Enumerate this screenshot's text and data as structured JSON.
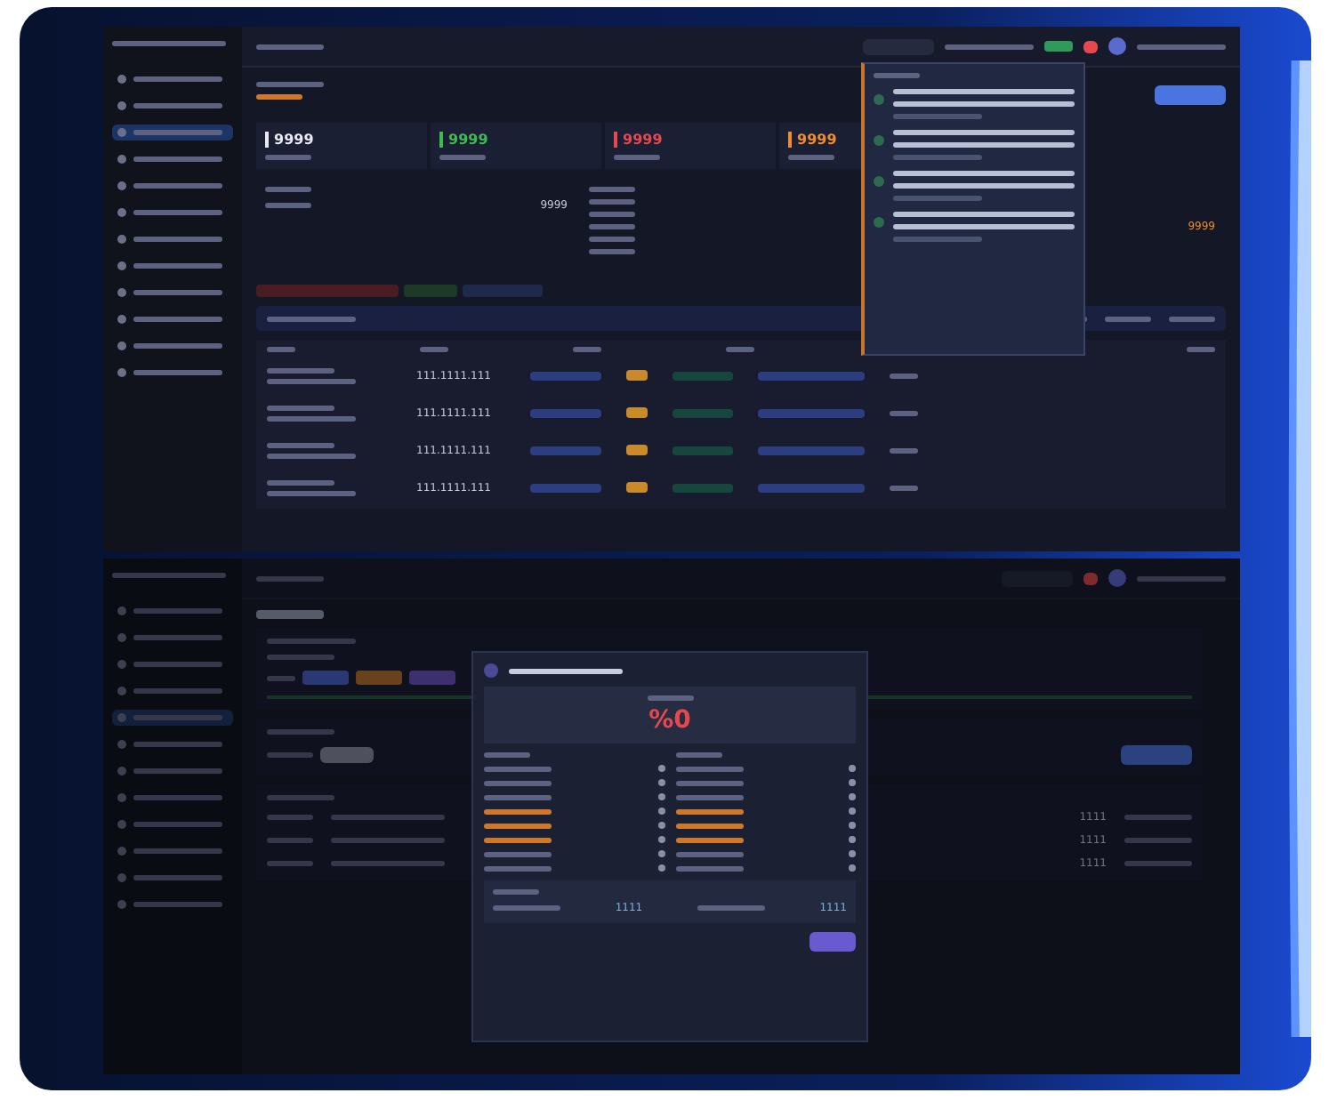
{
  "top_screen": {
    "sidebar_items": [
      {
        "selected": false
      },
      {
        "selected": false
      },
      {
        "selected": true
      },
      {
        "selected": false
      },
      {
        "selected": false
      },
      {
        "selected": false
      },
      {
        "selected": false
      },
      {
        "selected": false
      },
      {
        "selected": false
      },
      {
        "selected": false
      },
      {
        "selected": false
      },
      {
        "selected": false
      }
    ],
    "stats": [
      {
        "value": "9999",
        "color": "#e8e8f0"
      },
      {
        "value": "9999",
        "color": "#3fb950"
      },
      {
        "value": "9999",
        "color": "#e5484d"
      },
      {
        "value": "9999",
        "color": "#f08c2e"
      }
    ],
    "panel_value": "9999",
    "side_value": "9999",
    "rows": [
      {
        "phone": "111.1111.111"
      },
      {
        "phone": "111.1111.111"
      },
      {
        "phone": "111.1111.111"
      },
      {
        "phone": "111.1111.111"
      }
    ]
  },
  "bottom_screen": {
    "sidebar_items": [
      {
        "selected": false
      },
      {
        "selected": false
      },
      {
        "selected": false
      },
      {
        "selected": false
      },
      {
        "selected": true
      },
      {
        "selected": false
      },
      {
        "selected": false
      },
      {
        "selected": false
      },
      {
        "selected": false
      },
      {
        "selected": false
      },
      {
        "selected": false
      },
      {
        "selected": false
      }
    ],
    "modal": {
      "percent": "%0",
      "summary_values": [
        "1111",
        "1111"
      ]
    },
    "table_values": [
      "1111",
      "1111",
      "1111"
    ]
  }
}
